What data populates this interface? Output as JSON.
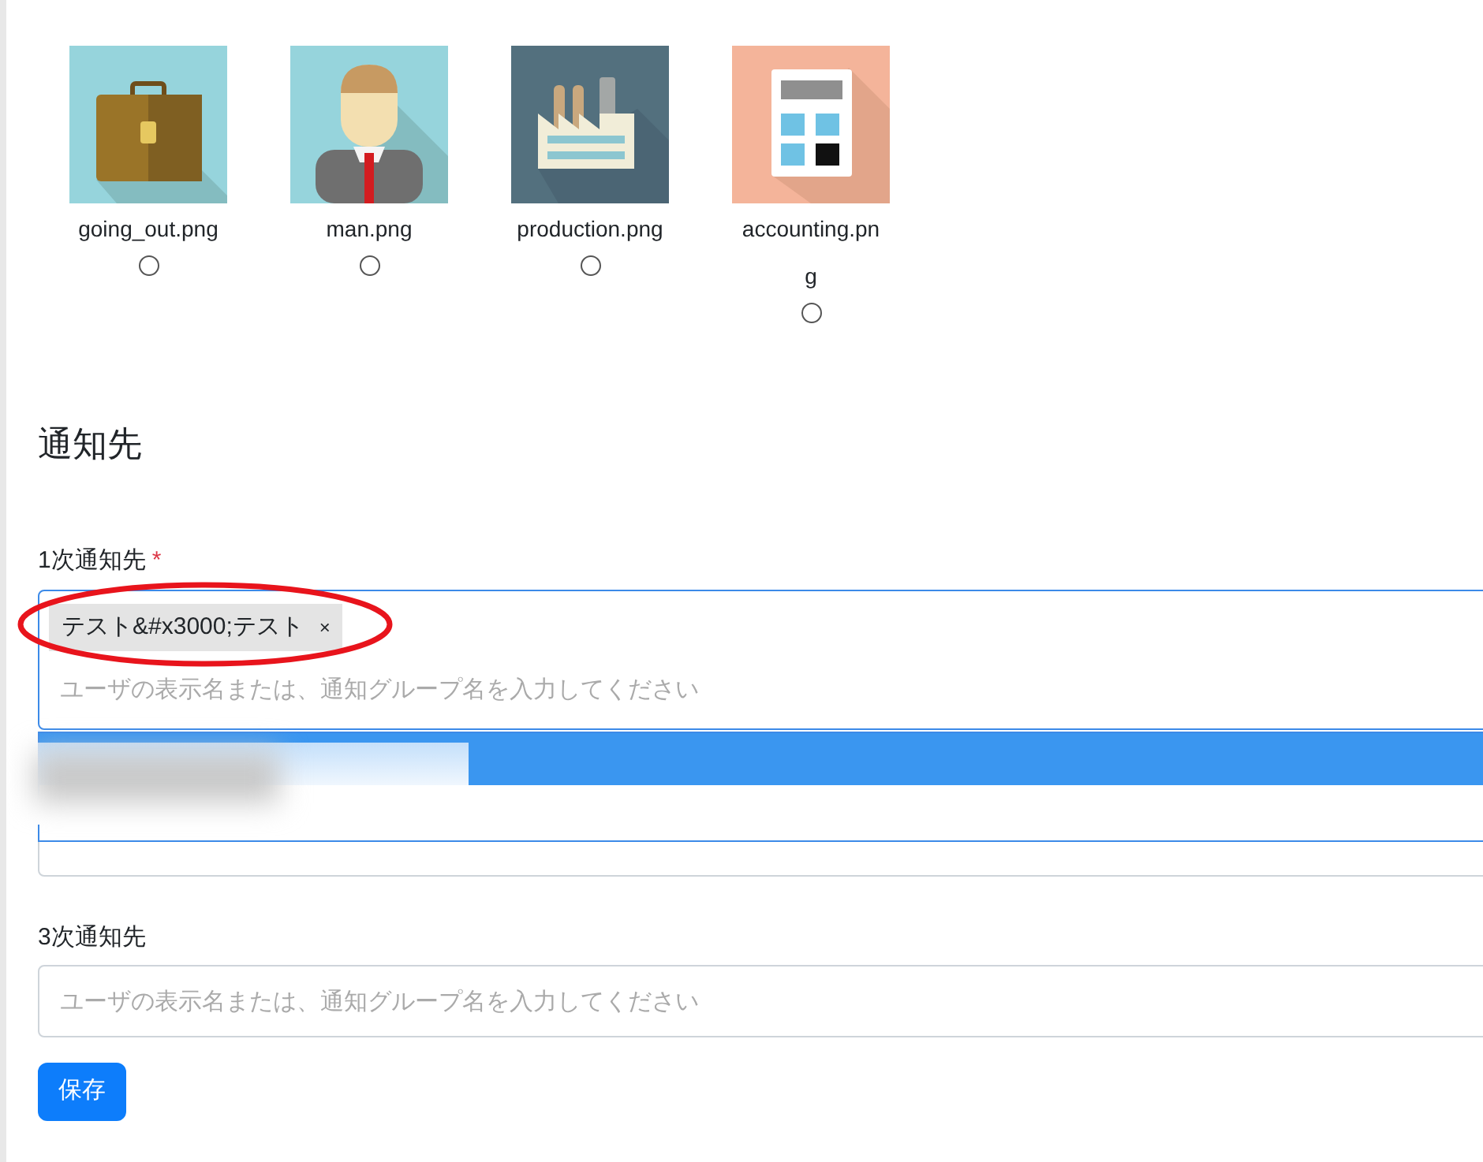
{
  "icons": [
    {
      "kind": "briefcase",
      "filename": "going_out.png",
      "selected": false
    },
    {
      "kind": "person",
      "filename": "man.png",
      "selected": false
    },
    {
      "kind": "factory",
      "filename": "production.png",
      "selected": false
    },
    {
      "kind": "calculator",
      "filename": "accounting.png",
      "selected": false
    }
  ],
  "section_title": "通知先",
  "primary": {
    "label": "1次通知先",
    "required_mark": "*",
    "chips": [
      {
        "label": "テスト&#x3000;テスト",
        "remove": "×"
      }
    ],
    "placeholder": "ユーザの表示名または、通知グループ名を入力してください"
  },
  "dropdown": {
    "items": [
      {
        "selected": true
      },
      {
        "selected": false
      }
    ]
  },
  "tertiary": {
    "label": "3次通知先",
    "placeholder": "ユーザの表示名または、通知グループ名を入力してください"
  },
  "save_button": "保存"
}
